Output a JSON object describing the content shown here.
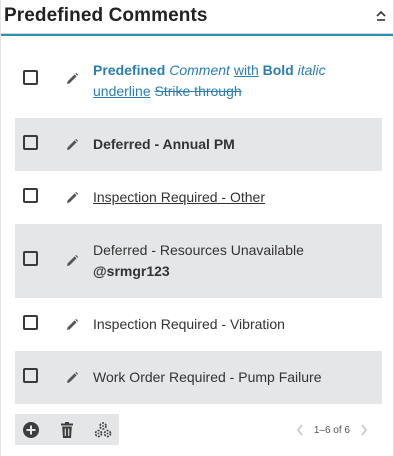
{
  "panel": {
    "title": "Predefined Comments",
    "collapse_icon": "chevron-up-icon"
  },
  "colors": {
    "accent": "#2a8fb3",
    "row_shade": "#e4e6e8",
    "link_blue": "#2a7fb0"
  },
  "comments": [
    {
      "parts": {
        "predefined": "Predefined",
        "comment": "Comment",
        "with": "with",
        "bold": "Bold",
        "italic": "italic",
        "underline": "underline",
        "strike": "Strike through"
      }
    },
    {
      "text": "Deferred - Annual PM"
    },
    {
      "text": "Inspection Required - Other"
    },
    {
      "line1": "Deferred - Resources Unavailable",
      "line2": "@srmgr123"
    },
    {
      "text": "Inspection Required - Vibration"
    },
    {
      "text": "Work Order Required - Pump Failure"
    }
  ],
  "toolbar": {
    "add_icon": "add-circle-icon",
    "delete_icon": "trash-icon",
    "settings_icon": "gears-icon"
  },
  "pagination": {
    "range_text": "1–6 of 6",
    "prev_icon": "chevron-left-icon",
    "next_icon": "chevron-right-icon"
  }
}
